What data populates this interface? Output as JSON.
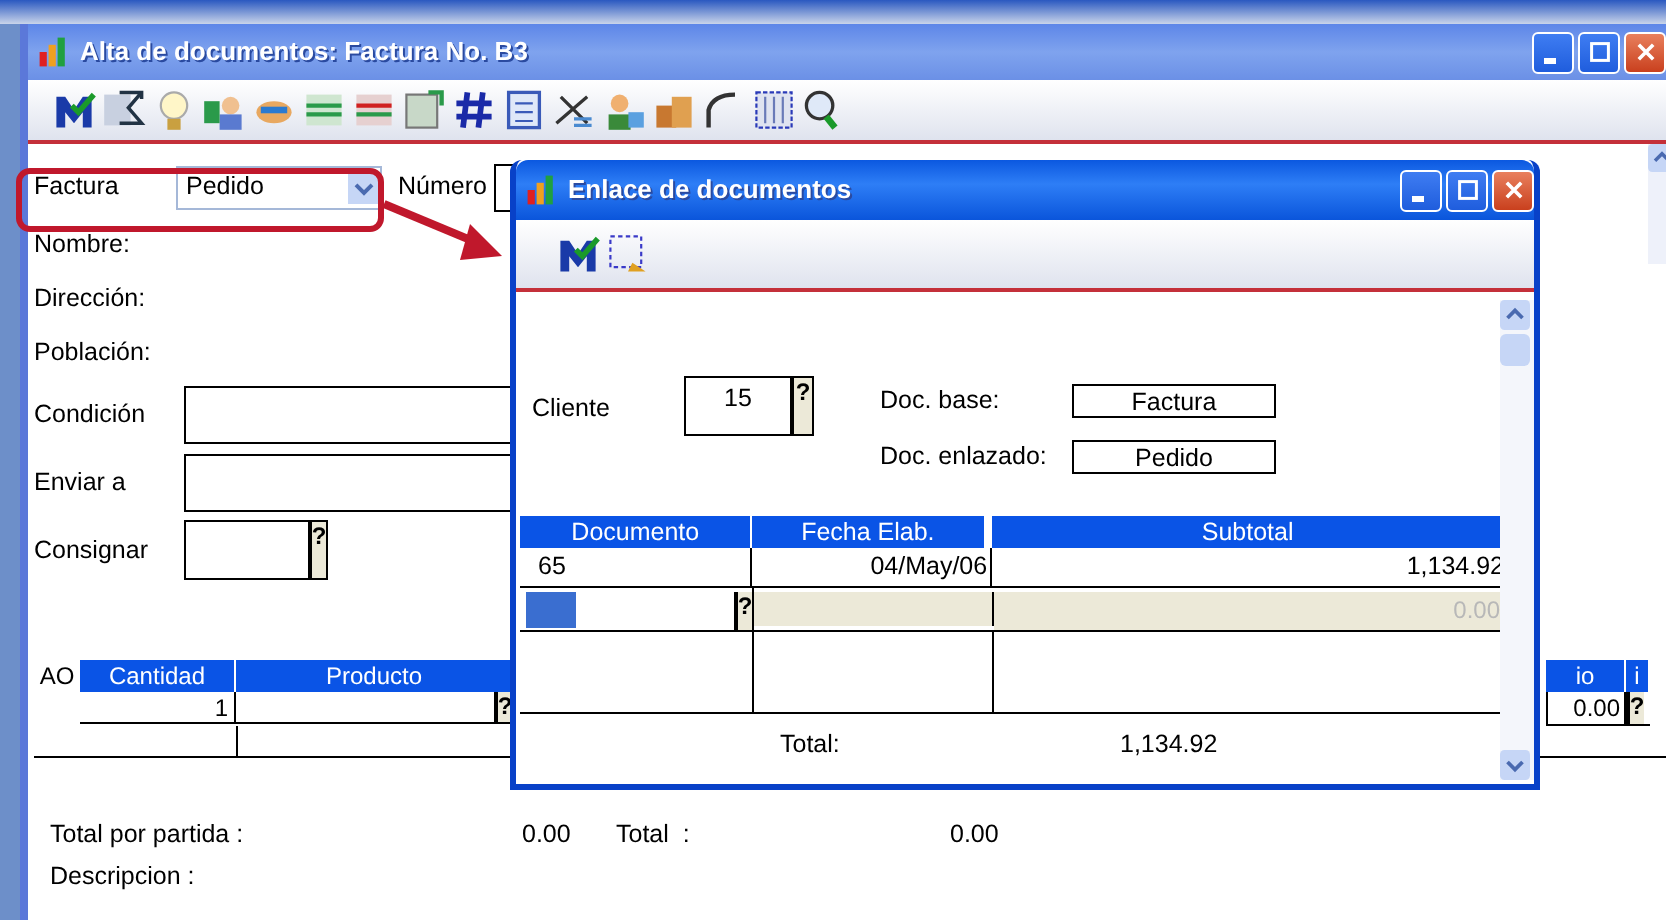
{
  "main_window": {
    "title": "Alta de documentos: Factura No. B3",
    "header": {
      "doc_type_label": "Factura",
      "doc_type_value": "Pedido",
      "number_label": "Número"
    },
    "fields": [
      {
        "label": "Nombre:",
        "kind": "text"
      },
      {
        "label": "Dirección:",
        "kind": "text"
      },
      {
        "label": "Población:",
        "kind": "text"
      },
      {
        "label": "Condición",
        "kind": "input"
      },
      {
        "label": "Enviar a",
        "kind": "input"
      },
      {
        "label": "Consignar",
        "kind": "lookup",
        "lookup": "?"
      }
    ],
    "grid": {
      "columns": [
        "AO",
        "Cantidad",
        "Producto",
        "io",
        "i"
      ],
      "row": {
        "quantity": "1",
        "product_lookup": "?",
        "column_4": "0.00",
        "column_4_lookup": "?"
      }
    },
    "totals": [
      {
        "label": "Total por partida :",
        "value": "0.00"
      },
      {
        "label": "Total  :",
        "value": "0.00"
      }
    ],
    "description_label": "Descripcion :"
  },
  "dialog": {
    "title": "Enlace de documentos",
    "cliente_label": "Cliente",
    "cliente_value": "15",
    "cliente_lookup": "?",
    "doc_base_label": "Doc. base:",
    "doc_base_value": "Factura",
    "doc_linked_label": "Doc. enlazado:",
    "doc_linked_value": "Pedido",
    "columns": [
      "Documento",
      "Fecha Elab.",
      "Subtotal"
    ],
    "rows": [
      [
        "65",
        "04/May/06",
        "1,134.92"
      ]
    ],
    "new_row": {
      "lookup": "?",
      "subtotal": "0.00"
    },
    "total_label": "Total:",
    "total_value": "1,134.92"
  }
}
